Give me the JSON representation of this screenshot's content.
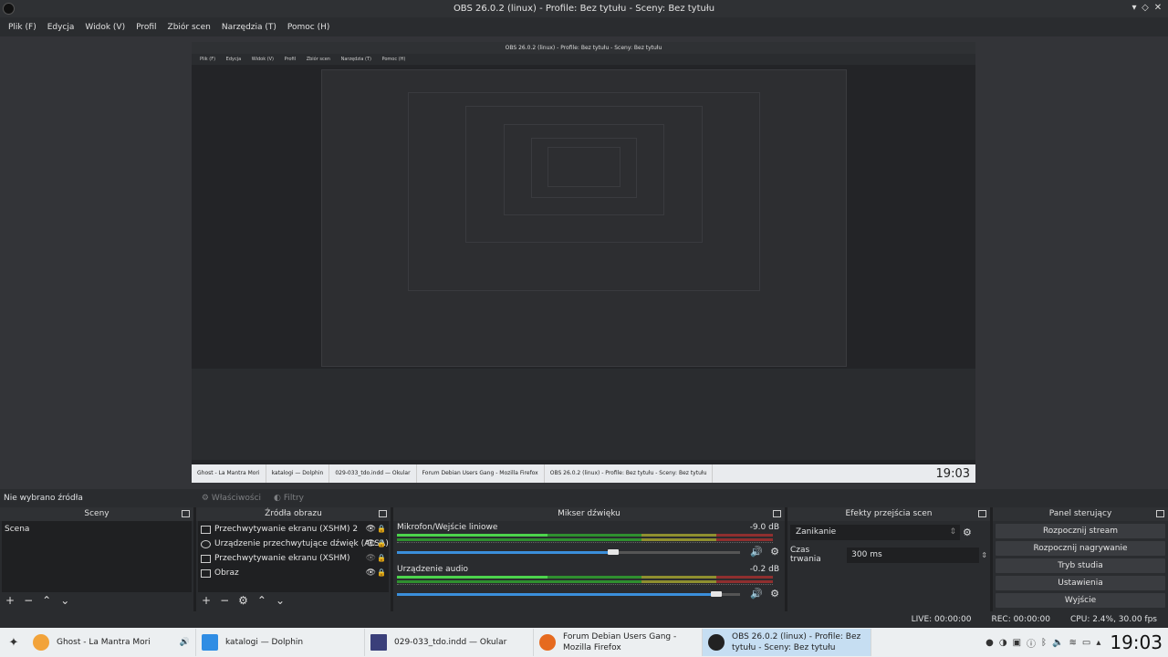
{
  "window": {
    "title": "OBS 26.0.2 (linux) - Profile: Bez tytułu - Sceny: Bez tytułu",
    "controls": [
      "▾",
      "◇",
      "✕"
    ]
  },
  "menu": [
    "Plik (F)",
    "Edycja",
    "Widok (V)",
    "Profil",
    "Zbiór scen",
    "Narzędzia (T)",
    "Pomoc (H)"
  ],
  "preview": {
    "title": "OBS 26.0.2 (linux) - Profile: Bez tytułu - Sceny: Bez tytułu",
    "menu": [
      "Plik (F)",
      "Edycja",
      "Widok (V)",
      "Profil",
      "Zbiór scen",
      "Narzędzia (T)",
      "Pomoc (H)"
    ],
    "taskbar": [
      "Ghost - La Mantra Mori",
      "katalogi — Dolphin",
      "029-033_tdo.indd — Okular",
      "Forum Debian Users Gang - Mozilla Firefox",
      "OBS 26.0.2 (linux) - Profile: Bez tytułu - Sceny: Bez tytułu"
    ],
    "clock": "19:03"
  },
  "source_bar": {
    "no_source": "Nie wybrano źródła",
    "properties": "Właściwości",
    "filters": "Filtry"
  },
  "scenes": {
    "title": "Sceny",
    "items": [
      "Scena"
    ]
  },
  "sources": {
    "title": "Źródła obrazu",
    "items": [
      "Przechwytywanie ekranu (XSHM) 2",
      "Urządzenie przechwytujące dźwięk (ALSA)",
      "Przechwytywanie ekranu (XSHM)",
      "Obraz"
    ]
  },
  "mixer": {
    "title": "Mikser dźwięku",
    "channels": [
      {
        "name": "Mikrofon/Wejście liniowe",
        "db": "-9.0 dB",
        "volume": 0.63
      },
      {
        "name": "Urządzenie audio",
        "db": "-0.2 dB",
        "volume": 0.93
      }
    ]
  },
  "transitions": {
    "title": "Efekty przejścia scen",
    "selected": "Zanikanie",
    "duration_label": "Czas trwania",
    "duration_value": "300 ms"
  },
  "controls": {
    "title": "Panel sterujący",
    "buttons": [
      "Rozpocznij stream",
      "Rozpocznij nagrywanie",
      "Tryb studia",
      "Ustawienia",
      "Wyjście"
    ]
  },
  "status": {
    "live": "LIVE: 00:00:00",
    "rec": "REC: 00:00:00",
    "cpu": "CPU: 2.4%, 30.00 fps"
  },
  "taskbar": {
    "tasks": [
      {
        "label": "Ghost - La Mantra Mori",
        "color": "#f2a33a"
      },
      {
        "label": "katalogi — Dolphin",
        "color": "#2f8de4"
      },
      {
        "label": "029-033_tdo.indd — Okular",
        "color": "#3a3f7a"
      },
      {
        "label": "Forum Debian Users Gang - Mozilla Firefox",
        "color": "#e66a1f"
      },
      {
        "label": "OBS 26.0.2 (linux) - Profile: Bez tytułu - Sceny: Bez tytułu",
        "color": "#222222"
      }
    ],
    "clock": "19:03"
  }
}
